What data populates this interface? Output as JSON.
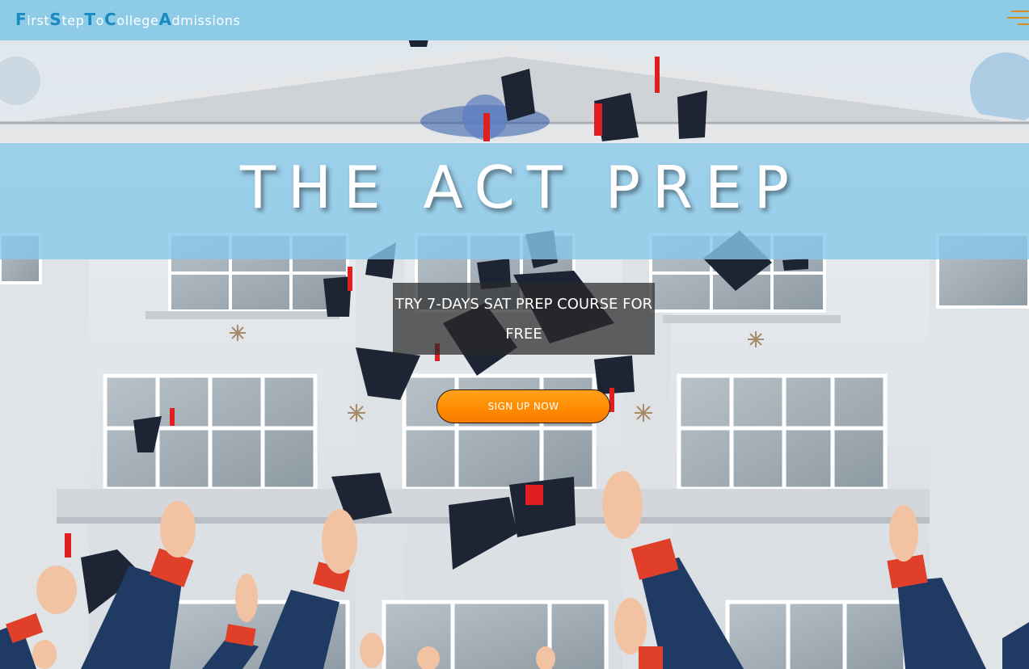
{
  "navbar": {
    "brand": [
      {
        "cap": "F",
        "rest": "irst"
      },
      {
        "cap": "S",
        "rest": "tep"
      },
      {
        "cap": "T",
        "rest": "o"
      },
      {
        "cap": "C",
        "rest": "ollege"
      },
      {
        "cap": "A",
        "rest": "dmissions"
      }
    ],
    "menu_icon": "hamburger-icon"
  },
  "hero": {
    "title": "THE ACT PREP",
    "promo_text": "TRY 7-DAYS SAT PREP COURSE FOR FREE",
    "cta_label": "SIGN UP NOW",
    "background_image": "graduates throwing caps in front of a university building"
  },
  "colors": {
    "navbar_bg": "#8ecbe7",
    "brand_accent": "#1a8ac2",
    "title_band": "#87c8e8",
    "cta_orange": "#ff8a00",
    "menu_icon": "#d98b1a"
  }
}
